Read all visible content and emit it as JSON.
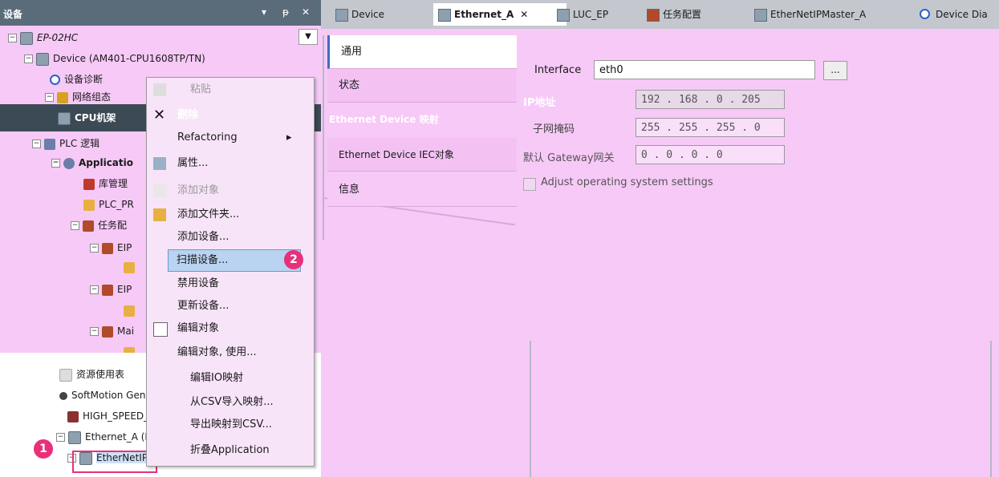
{
  "left_panel": {
    "title": "设备",
    "controls": [
      "▾",
      "ᵽ",
      "✕"
    ],
    "tree": [
      {
        "label": "EP-02HC",
        "italic": true
      },
      {
        "label": "Device (AM401-CPU1608TP/TN)"
      },
      {
        "label": "设备诊断"
      },
      {
        "label": "网络组态"
      },
      {
        "label": "CPU机架"
      },
      {
        "label": "PLC 逻辑"
      },
      {
        "label": "Applicatio"
      },
      {
        "label": "库管理"
      },
      {
        "label": "PLC_PR"
      },
      {
        "label": "任务配"
      },
      {
        "label": "EIP"
      },
      {
        "label": "EIP"
      },
      {
        "label": "Mai"
      },
      {
        "label": "资源使用表"
      },
      {
        "label": "SoftMotion Gene"
      },
      {
        "label": "HIGH_SPEED_"
      },
      {
        "label": "Ethernet_A (Eth"
      },
      {
        "label": "EtherNetIP"
      }
    ]
  },
  "context_menu": {
    "items": [
      {
        "label": "粘贴",
        "disabled": true
      },
      {
        "label": "删除"
      },
      {
        "label": "Refactoring",
        "submenu": "▸"
      },
      {
        "label": "属性..."
      },
      {
        "label": "添加对象",
        "disabled": true
      },
      {
        "label": "添加文件夹..."
      },
      {
        "label": "添加设备..."
      },
      {
        "label": "扫描设备...",
        "highlighted": true
      },
      {
        "label": "禁用设备"
      },
      {
        "label": "更新设备..."
      },
      {
        "label": "编辑对象"
      },
      {
        "label": "编辑对象, 使用..."
      },
      {
        "label": "编辑IO映射"
      },
      {
        "label": "从CSV导入映射..."
      },
      {
        "label": "导出映射到CSV..."
      },
      {
        "label": "折叠Application"
      }
    ]
  },
  "badges": {
    "one": "1",
    "two": "2"
  },
  "tabs": [
    {
      "label": "Device"
    },
    {
      "label": "Ethernet_A",
      "active": true,
      "close": "✕"
    },
    {
      "label": "LUC_EP"
    },
    {
      "label": "任务配置"
    },
    {
      "label": "EtherNetIPMaster_A"
    },
    {
      "label": "Device Dia"
    }
  ],
  "side_tabs": [
    {
      "label": "通用",
      "active": true
    },
    {
      "label": "状态"
    },
    {
      "label": "Ethernet Device 映射"
    },
    {
      "label": "Ethernet Device IEC对象"
    },
    {
      "label": "信息"
    }
  ],
  "form": {
    "interface_label": "Interface",
    "interface_value": "eth0",
    "browse_label": "...",
    "ip_label": "IP地址",
    "ip_value": "192 . 168 .  0  . 205",
    "subnet_label": "子网掩码",
    "subnet_value": "255 . 255 . 255 .  0",
    "gateway_label": "默认 Gateway网关",
    "gateway_value": " 0  .  0  .  0  .  0",
    "adjust_label": "Adjust operating system settings"
  },
  "colors": {
    "accent": "#e8307a",
    "band": "#3c4a55",
    "highlight": "#b9d3f0"
  }
}
